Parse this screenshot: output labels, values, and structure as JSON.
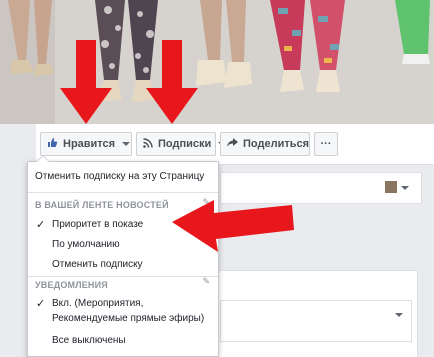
{
  "colors": {
    "arrow": "#e8171b",
    "accent": "#365899"
  },
  "actions": {
    "like_label": "Нравится",
    "subscribe_label": "Подписки",
    "share_label": "Поделиться",
    "more_label": "···"
  },
  "menu": {
    "unsubscribe_page": "Отменить подписку на эту Страницу",
    "news_feed_header": "В ВАШЕЙ ЛЕНТЕ НОВОСТЕЙ",
    "priority": "Приоритет в показе",
    "default": "По умолчанию",
    "unfollow": "Отменить подписку",
    "notifications_header": "УВЕДОМЛЕНИЯ",
    "on_line1": "Вкл. (Мероприятия,",
    "on_line2": "Рекомендуемые прямые эфиры)",
    "all_off": "Все выключены"
  },
  "icons": {
    "like": "thumbs-up-icon",
    "rss": "rss-icon",
    "share": "share-arrow-icon",
    "check": "checkmark-icon",
    "pencil": "pencil-icon"
  }
}
